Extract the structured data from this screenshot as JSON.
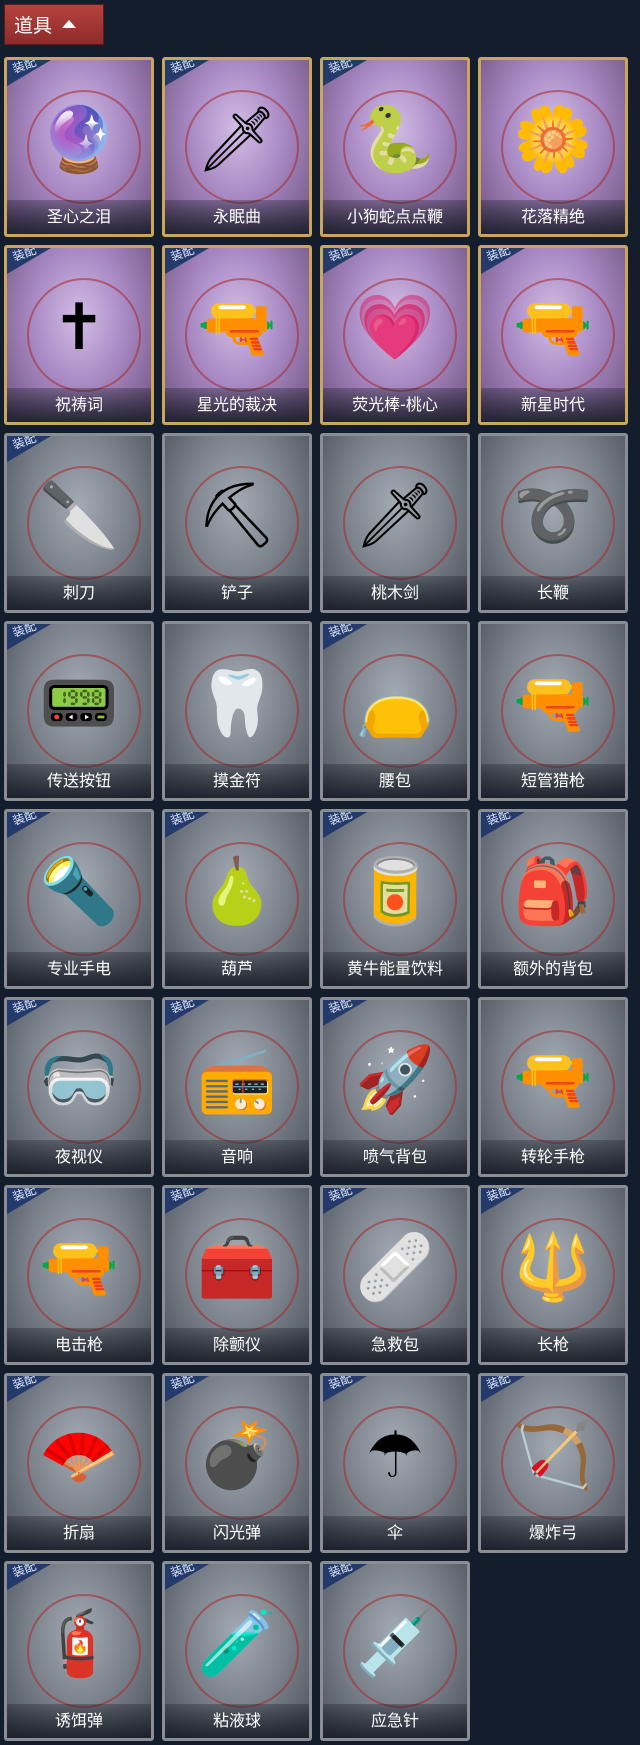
{
  "header": {
    "title": "道具"
  },
  "badge_text": "装配",
  "items": [
    {
      "label": "圣心之泪",
      "equipped": true,
      "theme": "purple",
      "icon": "heart-wand-icon",
      "glyph": "🔮"
    },
    {
      "label": "永眠曲",
      "equipped": true,
      "theme": "purple",
      "icon": "sword-icon",
      "glyph": "🗡"
    },
    {
      "label": "小狗蛇点点鞭",
      "equipped": true,
      "theme": "purple",
      "icon": "snake-whip-icon",
      "glyph": "🐍"
    },
    {
      "label": "花落精绝",
      "equipped": false,
      "theme": "purple",
      "icon": "flower-pendant-icon",
      "glyph": "🌼"
    },
    {
      "label": "祝祷词",
      "equipped": true,
      "theme": "purple",
      "icon": "cross-pendant-icon",
      "glyph": "✝"
    },
    {
      "label": "星光的裁决",
      "equipped": true,
      "theme": "purple",
      "icon": "shotgun-icon",
      "glyph": "🔫"
    },
    {
      "label": "荧光棒-桃心",
      "equipped": true,
      "theme": "purple",
      "icon": "glow-wand-icon",
      "glyph": "💗"
    },
    {
      "label": "新星时代",
      "equipped": true,
      "theme": "purple",
      "icon": "revolver-icon",
      "glyph": "🔫"
    },
    {
      "label": "刺刀",
      "equipped": true,
      "theme": "grey",
      "icon": "bayonet-icon",
      "glyph": "🔪"
    },
    {
      "label": "铲子",
      "equipped": false,
      "theme": "grey",
      "icon": "shovel-icon",
      "glyph": "⛏"
    },
    {
      "label": "桃木剑",
      "equipped": false,
      "theme": "grey",
      "icon": "wooden-sword-icon",
      "glyph": "🗡"
    },
    {
      "label": "长鞭",
      "equipped": false,
      "theme": "grey",
      "icon": "whip-icon",
      "glyph": "➰"
    },
    {
      "label": "传送按钮",
      "equipped": true,
      "theme": "grey",
      "icon": "teleport-button-icon",
      "glyph": "📟"
    },
    {
      "label": "摸金符",
      "equipped": false,
      "theme": "grey",
      "icon": "talisman-icon",
      "glyph": "🦷"
    },
    {
      "label": "腰包",
      "equipped": true,
      "theme": "grey",
      "icon": "waist-bag-icon",
      "glyph": "👝"
    },
    {
      "label": "短管猎枪",
      "equipped": false,
      "theme": "grey",
      "icon": "sawed-off-shotgun-icon",
      "glyph": "🔫"
    },
    {
      "label": "专业手电",
      "equipped": true,
      "theme": "grey",
      "icon": "flashlight-icon",
      "glyph": "🔦"
    },
    {
      "label": "葫芦",
      "equipped": true,
      "theme": "grey",
      "icon": "gourd-icon",
      "glyph": "🍐"
    },
    {
      "label": "黄牛能量饮料",
      "equipped": true,
      "theme": "grey",
      "icon": "energy-drink-icon",
      "glyph": "🥫"
    },
    {
      "label": "额外的背包",
      "equipped": true,
      "theme": "grey",
      "icon": "backpack-icon",
      "glyph": "🎒"
    },
    {
      "label": "夜视仪",
      "equipped": true,
      "theme": "grey",
      "icon": "night-vision-icon",
      "glyph": "🥽"
    },
    {
      "label": "音响",
      "equipped": true,
      "theme": "grey",
      "icon": "boombox-icon",
      "glyph": "📻"
    },
    {
      "label": "喷气背包",
      "equipped": true,
      "theme": "grey",
      "icon": "jetpack-icon",
      "glyph": "🚀"
    },
    {
      "label": "转轮手枪",
      "equipped": false,
      "theme": "grey",
      "icon": "revolver-icon",
      "glyph": "🔫"
    },
    {
      "label": "电击枪",
      "equipped": true,
      "theme": "grey",
      "icon": "stun-gun-icon",
      "glyph": "🔫"
    },
    {
      "label": "除颤仪",
      "equipped": true,
      "theme": "grey",
      "icon": "defibrillator-icon",
      "glyph": "🧰"
    },
    {
      "label": "急救包",
      "equipped": true,
      "theme": "grey",
      "icon": "first-aid-kit-icon",
      "glyph": "🩹"
    },
    {
      "label": "长枪",
      "equipped": true,
      "theme": "grey",
      "icon": "spear-icon",
      "glyph": "🔱"
    },
    {
      "label": "折扇",
      "equipped": true,
      "theme": "grey",
      "icon": "folding-fan-icon",
      "glyph": "🪭"
    },
    {
      "label": "闪光弹",
      "equipped": true,
      "theme": "grey",
      "icon": "flashbang-icon",
      "glyph": "💣"
    },
    {
      "label": "伞",
      "equipped": true,
      "theme": "grey",
      "icon": "umbrella-icon",
      "glyph": "☂"
    },
    {
      "label": "爆炸弓",
      "equipped": true,
      "theme": "grey",
      "icon": "bow-icon",
      "glyph": "🏹"
    },
    {
      "label": "诱饵弹",
      "equipped": true,
      "theme": "grey",
      "icon": "decoy-grenade-icon",
      "glyph": "🧯"
    },
    {
      "label": "粘液球",
      "equipped": true,
      "theme": "grey",
      "icon": "slime-ball-icon",
      "glyph": "🧪"
    },
    {
      "label": "应急针",
      "equipped": true,
      "theme": "grey",
      "icon": "syringe-icon",
      "glyph": "💉"
    }
  ]
}
